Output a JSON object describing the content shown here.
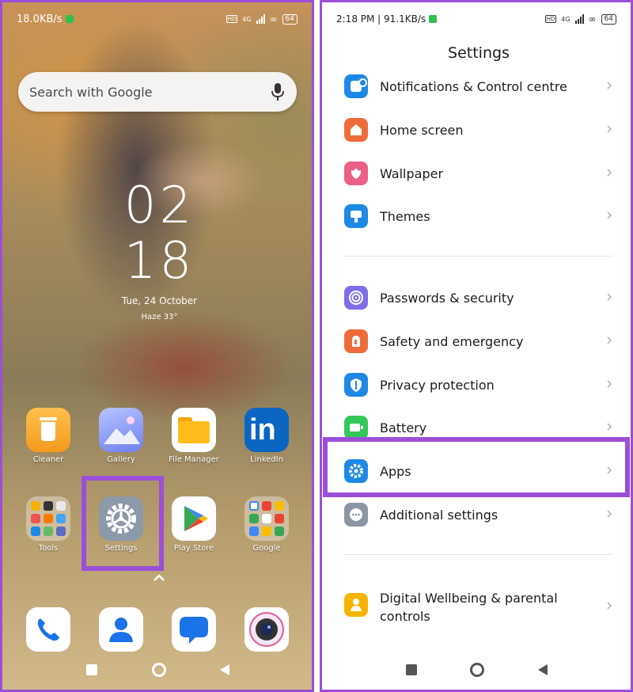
{
  "left_phone": {
    "status": {
      "speed": "18.0KB/s",
      "network": "4G",
      "battery": "64"
    },
    "search": {
      "placeholder": "Search with Google"
    },
    "clock": {
      "hour": "02",
      "minute": "18"
    },
    "date": "Tue, 24 October",
    "weather": "Haze 33°",
    "apps_row1": [
      {
        "label": "Cleaner",
        "icon": "cleaner-icon",
        "color": "#f6a623"
      },
      {
        "label": "Gallery",
        "icon": "gallery-icon",
        "color": "#7b8cf0"
      },
      {
        "label": "File Manager",
        "icon": "file-manager-icon",
        "color": "#f7b200"
      },
      {
        "label": "LinkedIn",
        "icon": "linkedin-icon",
        "color": "#0a66c2"
      }
    ],
    "apps_row2": [
      {
        "label": "Tools",
        "icon": "tools-folder-icon"
      },
      {
        "label": "Settings",
        "icon": "settings-gear-icon",
        "color": "#8c99a8"
      },
      {
        "label": "Play Store",
        "icon": "play-store-icon"
      },
      {
        "label": "Google",
        "icon": "google-folder-icon"
      }
    ],
    "dock": [
      {
        "icon": "phone-icon",
        "color": "#1a73e8"
      },
      {
        "icon": "contacts-icon",
        "color": "#1a73e8"
      },
      {
        "icon": "messages-icon",
        "color": "#1a73e8"
      },
      {
        "icon": "camera-icon",
        "color": "#333333"
      }
    ],
    "nav": [
      "recents-icon",
      "home-icon",
      "back-icon"
    ]
  },
  "right_phone": {
    "status": {
      "time": "2:18 PM",
      "speed": "91.1KB/s",
      "network": "4G",
      "battery": "64"
    },
    "title": "Settings",
    "items": [
      {
        "label": "Notifications & Control centre",
        "icon": "notifications-icon",
        "color": "#1e88e5"
      },
      {
        "label": "Home screen",
        "icon": "home-screen-icon",
        "color": "#ef6c3a"
      },
      {
        "label": "Wallpaper",
        "icon": "wallpaper-icon",
        "color": "#ec5f86"
      },
      {
        "label": "Themes",
        "icon": "themes-icon",
        "color": "#1e88e5"
      },
      {
        "label": "Passwords & security",
        "icon": "fingerprint-icon",
        "color": "#7e6ee8"
      },
      {
        "label": "Safety and emergency",
        "icon": "emergency-icon",
        "color": "#ef6c3a"
      },
      {
        "label": "Privacy protection",
        "icon": "privacy-icon",
        "color": "#1e88e5"
      },
      {
        "label": "Battery",
        "icon": "battery-icon",
        "color": "#34c759"
      },
      {
        "label": "Apps",
        "icon": "apps-gear-icon",
        "color": "#1e88e5"
      },
      {
        "label": "Additional settings",
        "icon": "more-dots-icon",
        "color": "#8a96a3"
      },
      {
        "label": "Digital Wellbeing & parental controls",
        "icon": "wellbeing-icon",
        "color": "#f5b400"
      }
    ],
    "highlight_color": "#9b4fd9"
  }
}
